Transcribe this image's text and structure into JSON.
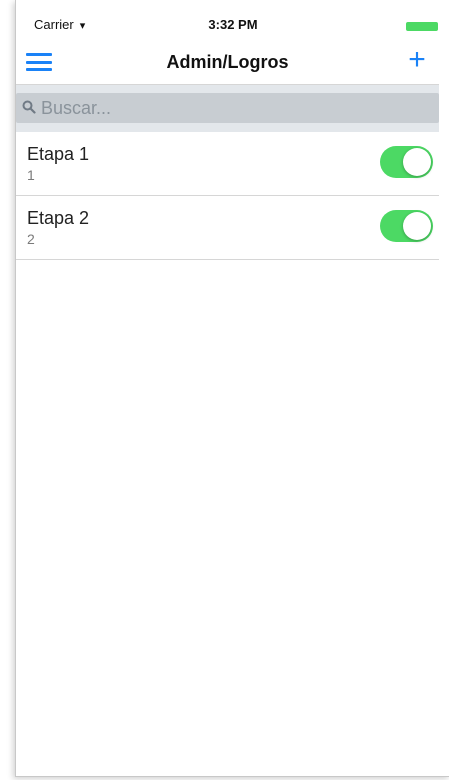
{
  "status_bar": {
    "carrier": "Carrier",
    "time": "3:32 PM"
  },
  "nav": {
    "title": "Admin/Logros",
    "menu_icon": "hamburger-menu-icon",
    "add_icon": "plus-icon"
  },
  "search": {
    "placeholder": "Buscar...",
    "icon": "search-icon"
  },
  "items": [
    {
      "title": "Etapa 1",
      "subtitle": "1",
      "enabled": true
    },
    {
      "title": "Etapa 2",
      "subtitle": "2",
      "enabled": true
    }
  ],
  "colors": {
    "accent": "#1a82f7",
    "toggle_on": "#4cd964"
  }
}
